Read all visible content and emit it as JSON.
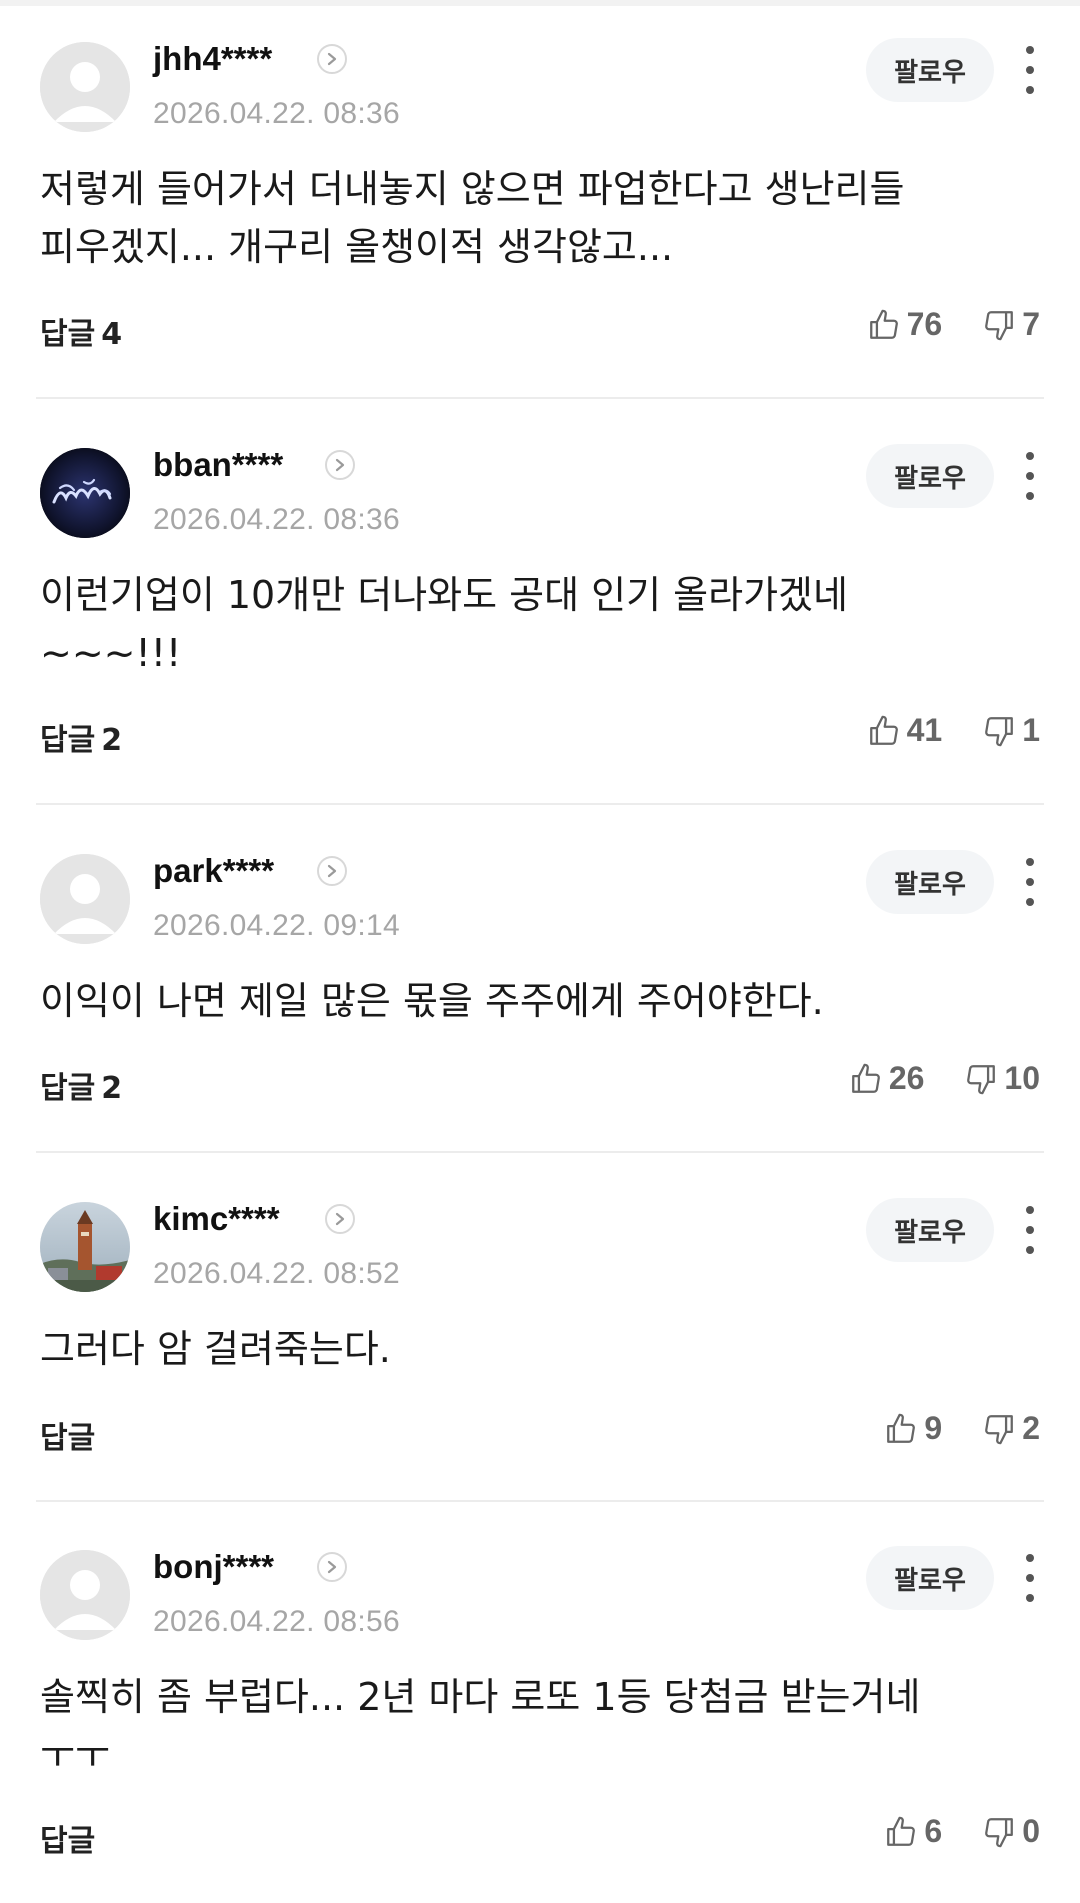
{
  "follow_label": "팔로우",
  "reply_label": "답글",
  "comments": [
    {
      "username": "jhh4****",
      "timestamp": "2026.04.22. 08:36",
      "avatar": "default-avatar-icon",
      "text": "저렇게 들어가서 더내놓지 않으면 파업한다고 생난리들 피우겠지... 개구리 올챙이적 생각않고...",
      "reply_count": "4",
      "likes": "76",
      "dislikes": "7"
    },
    {
      "username": "bban****",
      "timestamp": "2026.04.22. 08:36",
      "avatar": "custom-avatar-dark",
      "text": "이런기업이 10개만 더나와도 공대 인기 올라가겠네 ~~~!!!",
      "reply_count": "2",
      "likes": "41",
      "dislikes": "1"
    },
    {
      "username": "park****",
      "timestamp": "2026.04.22. 09:14",
      "avatar": "default-avatar-icon",
      "text": "이익이 나면 제일 많은 몫을 주주에게 주어야한다.",
      "reply_count": "2",
      "likes": "26",
      "dislikes": "10"
    },
    {
      "username": "kimc****",
      "timestamp": "2026.04.22. 08:52",
      "avatar": "photo-avatar-tower",
      "text": "그러다 암 걸려죽는다.",
      "reply_count": "",
      "likes": "9",
      "dislikes": "2"
    },
    {
      "username": "bonj****",
      "timestamp": "2026.04.22. 08:56",
      "avatar": "default-avatar-icon",
      "text": "솔찍히 좀 부럽다... 2년 마다 로또 1등 당첨금 받는거네 ㅜㅜ",
      "reply_count": "",
      "likes": "6",
      "dislikes": "0"
    }
  ]
}
